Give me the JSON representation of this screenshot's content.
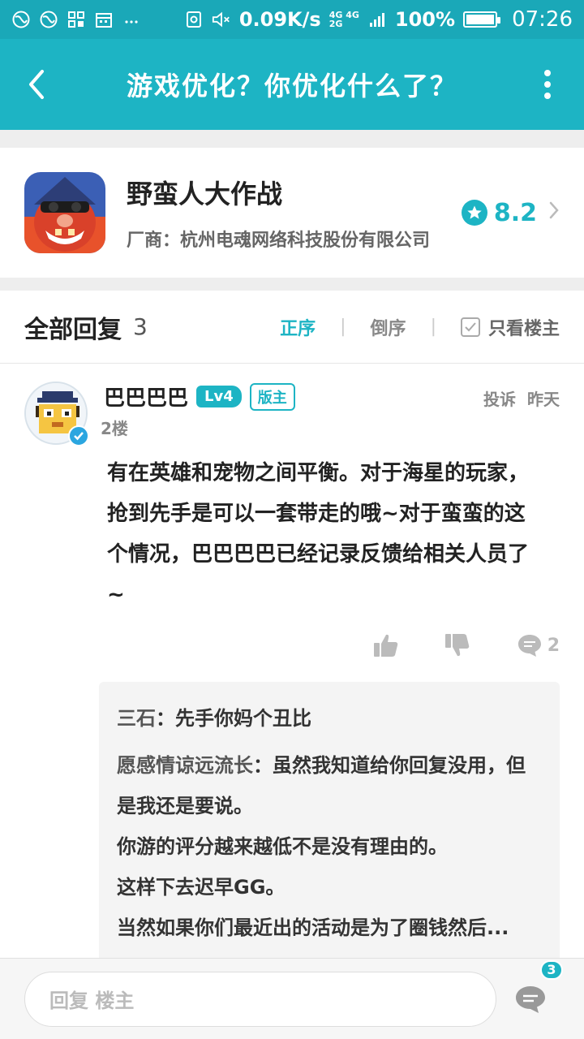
{
  "status_bar": {
    "speed": "0.09K/s",
    "network_top": "4G 4G",
    "network_bottom": "2G",
    "battery": "100%",
    "time": "07:26"
  },
  "app_bar": {
    "title": "游戏优化？你优化什么了？"
  },
  "game": {
    "name": "野蛮人大作战",
    "vendor": "厂商：杭州电魂网络科技股份有限公司",
    "score": "8.2"
  },
  "replies_header": {
    "title": "全部回复",
    "count": "3",
    "sort_asc": "正序",
    "sort_desc": "倒序",
    "owner_only": "只看楼主"
  },
  "post": {
    "author": "巴巴巴巴",
    "level": "Lv4",
    "role": "版主",
    "report": "投诉",
    "time": "昨天",
    "floor": "2楼",
    "body": "有在英雄和宠物之间平衡。对于海星的玩家，抢到先手是可以一套带走的哦~对于蛮蛮的这个情况，巴巴巴巴已经记录反馈给相关人员了~",
    "comment_count": "2",
    "sub_replies": [
      {
        "name": "三石",
        "text": "先手你妈个丑比"
      },
      {
        "name": "愿感情谅远流长",
        "text": "虽然我知道给你回复没用，但是我还是要说。"
      },
      {
        "name": "",
        "text": "你游的评分越来越低不是没有理由的。"
      },
      {
        "name": "",
        "text": "这样下去迟早GG。"
      },
      {
        "name": "",
        "text": "当然如果你们最近出的活动是为了圈钱然后..."
      }
    ]
  },
  "bottom_bar": {
    "placeholder": "回复 楼主",
    "comments_badge": "3"
  }
}
